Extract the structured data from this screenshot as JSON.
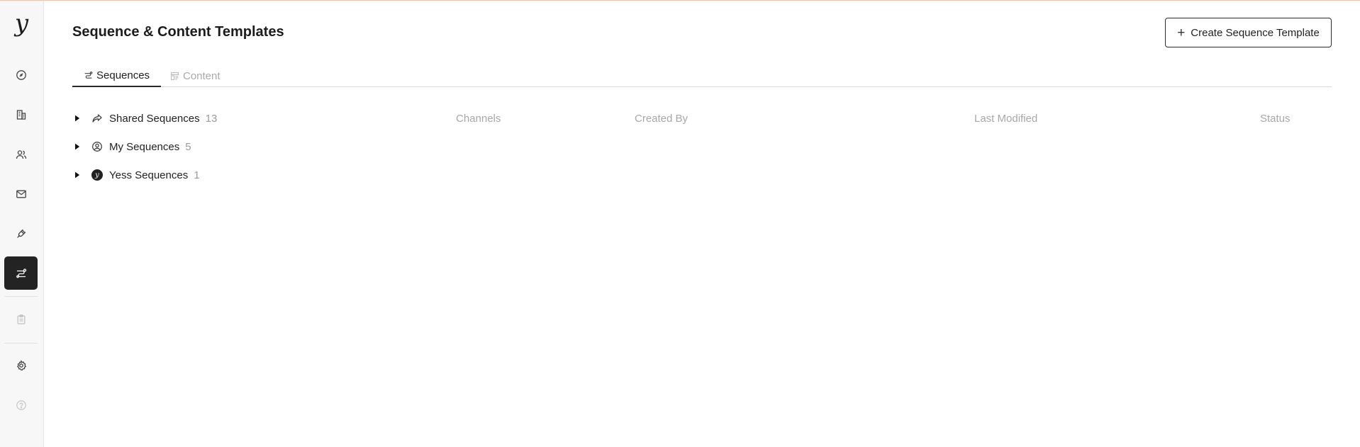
{
  "app": {
    "logo_text": "y"
  },
  "sidebar": {
    "items": [
      {
        "icon": "gauge-icon"
      },
      {
        "icon": "building-icon"
      },
      {
        "icon": "users-icon"
      },
      {
        "icon": "mail-icon"
      },
      {
        "icon": "plug-icon"
      },
      {
        "icon": "sequences-icon",
        "active": true
      },
      {
        "icon": "clipboard-icon",
        "disabled": true
      },
      {
        "icon": "gear-icon"
      },
      {
        "icon": "help-icon",
        "disabled": true
      }
    ]
  },
  "header": {
    "title": "Sequence & Content Templates",
    "create_button_label": "Create Sequence Template"
  },
  "tabs": [
    {
      "label": "Sequences",
      "active": true
    },
    {
      "label": "Content",
      "active": false
    }
  ],
  "table": {
    "columns": {
      "channels": "Channels",
      "created_by": "Created By",
      "last_modified": "Last Modified",
      "status": "Status"
    },
    "groups": [
      {
        "label": "Shared Sequences",
        "count": "13",
        "icon": "share-icon"
      },
      {
        "label": "My Sequences",
        "count": "5",
        "icon": "user-circle-icon"
      },
      {
        "label": "Yess Sequences",
        "count": "1",
        "icon": "yess-logo-icon"
      }
    ]
  },
  "colors": {
    "accent": "#232323",
    "muted_text": "#a7a7a7",
    "top_border": "#e8c3ad"
  }
}
